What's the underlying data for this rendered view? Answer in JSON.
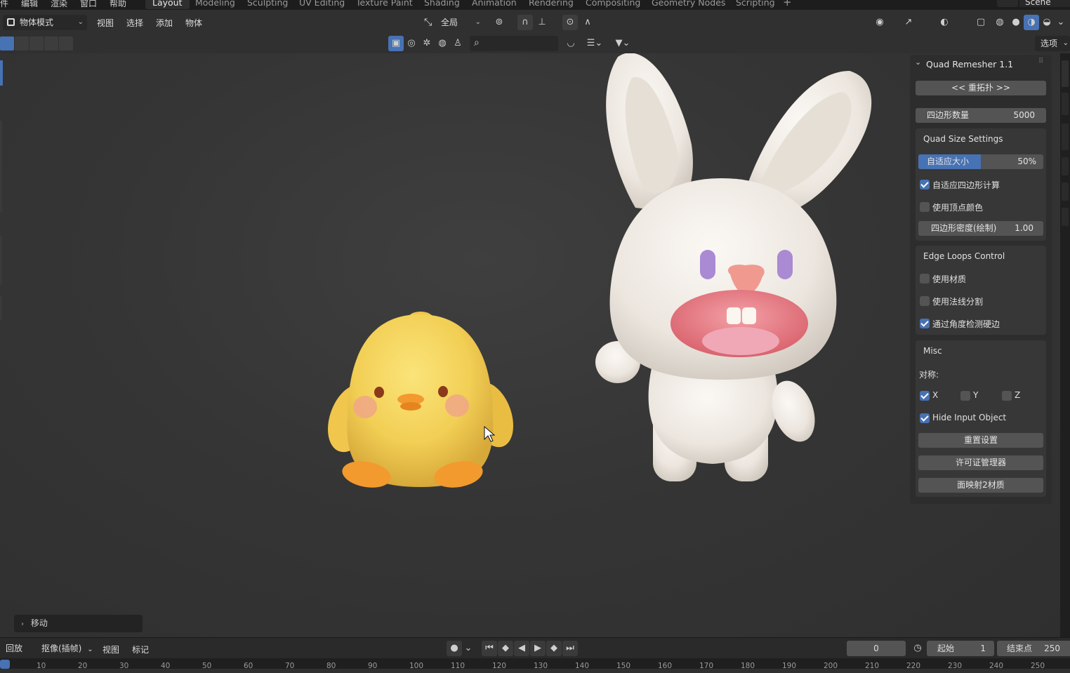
{
  "topbar": {
    "menus": [
      "编辑",
      "渲染",
      "窗口",
      "帮助"
    ],
    "workspaces": [
      "Layout",
      "Modeling",
      "Sculpting",
      "UV Editing",
      "Texture Paint",
      "Shading",
      "Animation",
      "Rendering",
      "Compositing",
      "Geometry Nodes",
      "Scripting"
    ],
    "active_workspace": "Layout",
    "add_tab": "+",
    "scene": "Scene"
  },
  "header": {
    "mode": "物体模式",
    "menus": [
      "视图",
      "选择",
      "添加",
      "物体"
    ],
    "orientation": "全局",
    "options": "选项"
  },
  "toolbar2": {
    "search_placeholder": ""
  },
  "npanel": {
    "title": "Quad Remesher 1.1",
    "remesh_button": "<< 重拓扑 >>",
    "quad_count_label": "四边形数量",
    "quad_count_value": "5000",
    "quad_size": {
      "title": "Quad Size Settings",
      "adaptive_label": "自适应大小",
      "adaptive_value": "50%",
      "adaptive_fraction": 0.5,
      "adaptive_calc_label": "自适应四边形计算",
      "adaptive_calc_checked": true,
      "vertex_color_label": "使用顶点颜色",
      "vertex_color_checked": false,
      "density_label": "四边形密度(绘制)",
      "density_value": "1.00"
    },
    "edge_loops": {
      "title": "Edge Loops Control",
      "use_materials_label": "使用材质",
      "use_materials_checked": false,
      "use_normals_label": "使用法线分割",
      "use_normals_checked": false,
      "detect_hard_label": "通过角度检测硬边",
      "detect_hard_checked": true
    },
    "misc": {
      "title": "Misc",
      "symmetry_label": "对称:",
      "x_label": "X",
      "x_checked": true,
      "y_label": "Y",
      "y_checked": false,
      "z_label": "Z",
      "z_checked": false,
      "hide_input_label": "Hide Input Object",
      "hide_input_checked": true,
      "reset_button": "重置设置",
      "license_button": "许可证管理器",
      "material_button": "面映射2材质"
    }
  },
  "operator_panel": {
    "label": "移动"
  },
  "timeline": {
    "playback": "回放",
    "keying": "抠像(插帧)",
    "view": "视图",
    "marker": "标记",
    "current_frame": "0",
    "start_label": "起始",
    "start_value": "1",
    "end_label": "结束点",
    "end_value": "250",
    "ruler_ticks": [
      "10",
      "20",
      "30",
      "40",
      "50",
      "60",
      "70",
      "80",
      "90",
      "100",
      "110",
      "120",
      "130",
      "140",
      "150",
      "160",
      "170",
      "180",
      "190",
      "200",
      "210",
      "220",
      "230",
      "240",
      "250"
    ]
  },
  "colors": {
    "accent": "#4772b3",
    "viewport_bg": "#393939",
    "chick_yellow": "#f2cf55",
    "bunny_white": "#f1ede8"
  }
}
